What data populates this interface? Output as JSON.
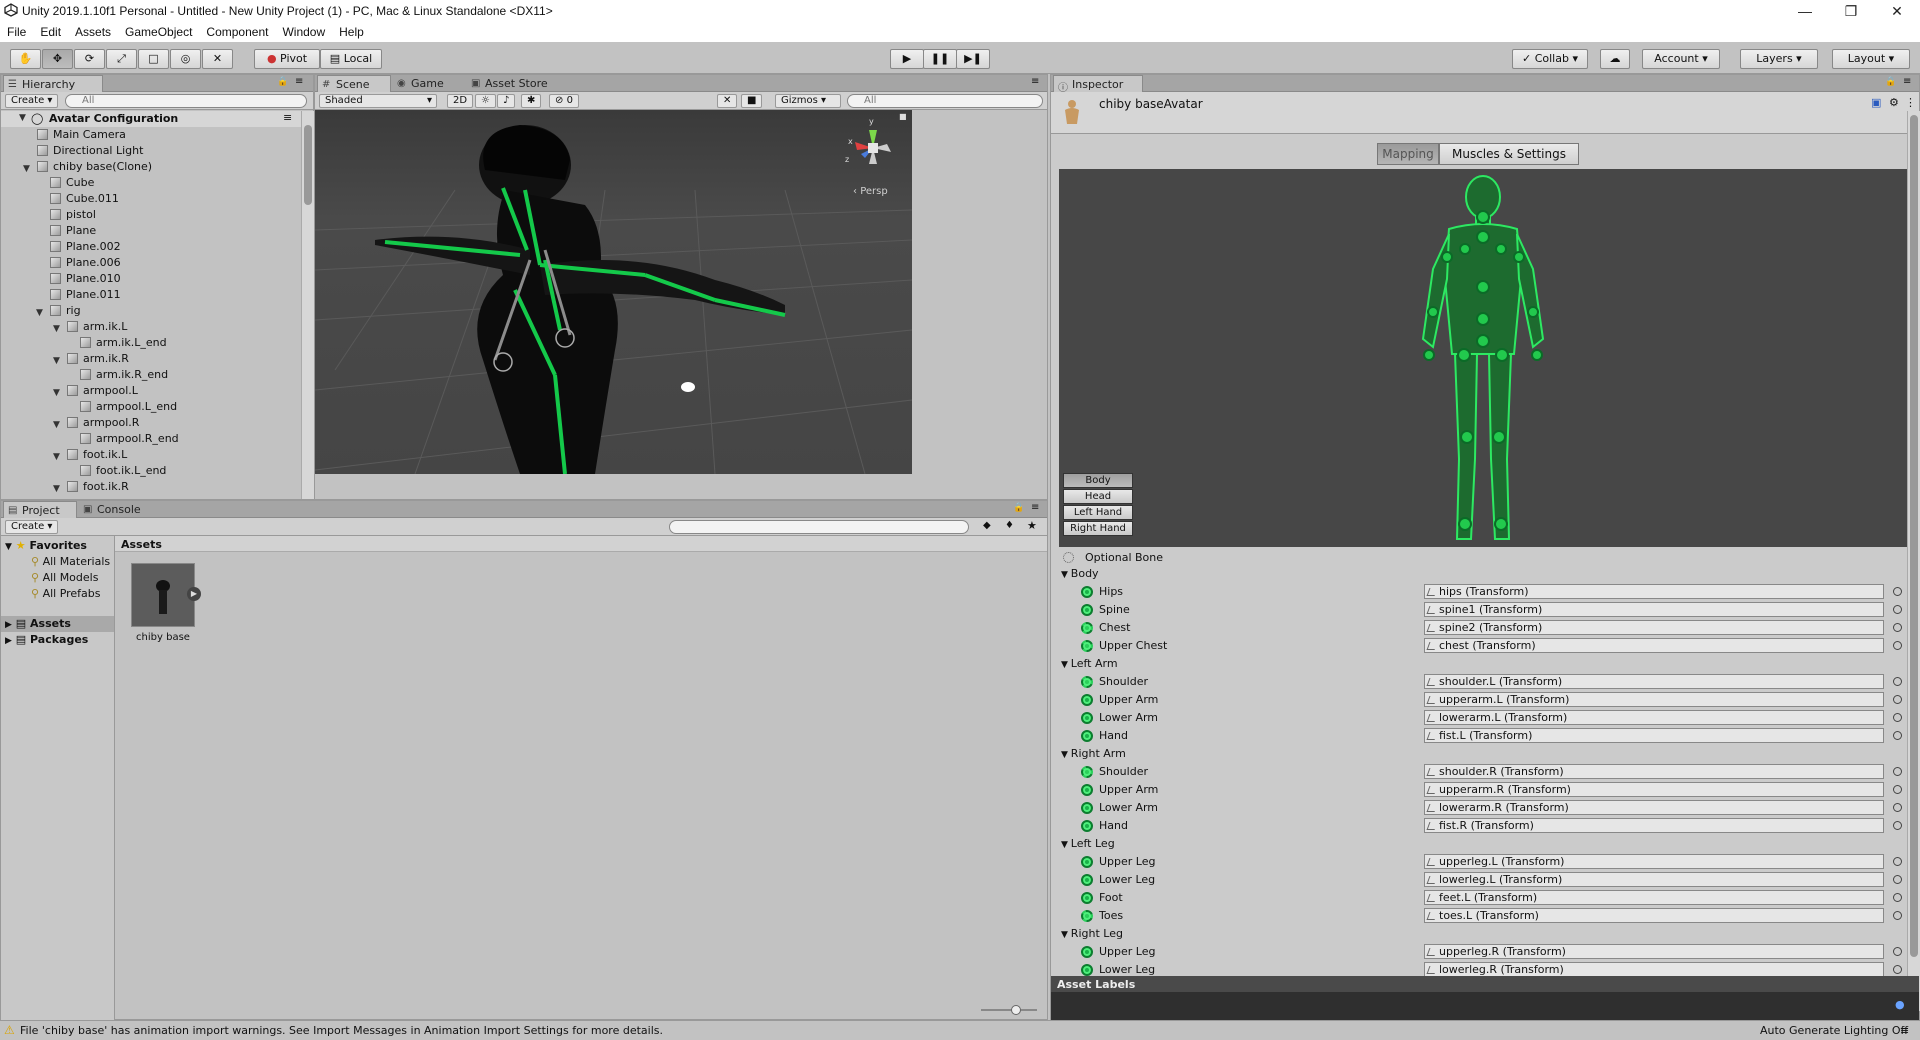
{
  "window": {
    "title": "Unity 2019.1.10f1 Personal - Untitled - New Unity Project (1) - PC, Mac & Linux Standalone <DX11>"
  },
  "menu": [
    "File",
    "Edit",
    "Assets",
    "GameObject",
    "Component",
    "Window",
    "Help"
  ],
  "toolbar": {
    "pivot": "Pivot",
    "local": "Local",
    "collab": "Collab ▾",
    "account": "Account ▾",
    "layers": "Layers ▾",
    "layout": "Layout ▾"
  },
  "hierarchy": {
    "tab": "Hierarchy",
    "create": "Create ▾",
    "search_placeholder": "All",
    "root": "Avatar Configuration",
    "items": [
      {
        "label": "Main Camera",
        "depth": 1
      },
      {
        "label": "Directional Light",
        "depth": 1
      },
      {
        "label": "chiby base(Clone)",
        "depth": 1,
        "expanded": true
      },
      {
        "label": "Cube",
        "depth": 2
      },
      {
        "label": "Cube.011",
        "depth": 2
      },
      {
        "label": "pistol",
        "depth": 2
      },
      {
        "label": "Plane",
        "depth": 2
      },
      {
        "label": "Plane.002",
        "depth": 2
      },
      {
        "label": "Plane.006",
        "depth": 2
      },
      {
        "label": "Plane.010",
        "depth": 2
      },
      {
        "label": "Plane.011",
        "depth": 2
      },
      {
        "label": "rig",
        "depth": 2,
        "expanded": true
      },
      {
        "label": "arm.ik.L",
        "depth": 3,
        "expanded": true
      },
      {
        "label": "arm.ik.L_end",
        "depth": 4
      },
      {
        "label": "arm.ik.R",
        "depth": 3,
        "expanded": true
      },
      {
        "label": "arm.ik.R_end",
        "depth": 4
      },
      {
        "label": "armpool.L",
        "depth": 3,
        "expanded": true
      },
      {
        "label": "armpool.L_end",
        "depth": 4
      },
      {
        "label": "armpool.R",
        "depth": 3,
        "expanded": true
      },
      {
        "label": "armpool.R_end",
        "depth": 4
      },
      {
        "label": "foot.ik.L",
        "depth": 3,
        "expanded": true
      },
      {
        "label": "foot.ik.L_end",
        "depth": 4
      },
      {
        "label": "foot.ik.R",
        "depth": 3,
        "expanded": true
      }
    ]
  },
  "scene": {
    "tabs": [
      "Scene",
      "Game",
      "Asset Store"
    ],
    "shading": "Shaded",
    "mode2d": "2D",
    "fx_count": "0",
    "gizmos": "Gizmos ▾",
    "search_placeholder": "All",
    "persp": "Persp",
    "axis_y": "y",
    "axis_x": "x",
    "axis_z": "z"
  },
  "project": {
    "tabs": [
      "Project",
      "Console"
    ],
    "create": "Create ▾",
    "favorites": "Favorites",
    "fav_items": [
      "All Materials",
      "All Models",
      "All Prefabs"
    ],
    "roots": [
      "Assets",
      "Packages"
    ],
    "assets_header": "Assets",
    "asset_name": "chiby base"
  },
  "inspector": {
    "tab": "Inspector",
    "object_name": "chiby baseAvatar",
    "mapping": "Mapping",
    "muscles": "Muscles & Settings",
    "body_buttons": [
      "Body",
      "Head",
      "Left Hand",
      "Right Hand"
    ],
    "optional_bone": "Optional Bone",
    "groups": [
      {
        "name": "Body",
        "bones": [
          {
            "label": "Hips",
            "value": "hips (Transform)",
            "optional": false
          },
          {
            "label": "Spine",
            "value": "spine1 (Transform)",
            "optional": false
          },
          {
            "label": "Chest",
            "value": "spine2 (Transform)",
            "optional": true
          },
          {
            "label": "Upper Chest",
            "value": "chest (Transform)",
            "optional": true
          }
        ]
      },
      {
        "name": "Left Arm",
        "bones": [
          {
            "label": "Shoulder",
            "value": "shoulder.L (Transform)",
            "optional": true
          },
          {
            "label": "Upper Arm",
            "value": "upperarm.L (Transform)",
            "optional": false
          },
          {
            "label": "Lower Arm",
            "value": "lowerarm.L (Transform)",
            "optional": false
          },
          {
            "label": "Hand",
            "value": "fist.L (Transform)",
            "optional": false
          }
        ]
      },
      {
        "name": "Right Arm",
        "bones": [
          {
            "label": "Shoulder",
            "value": "shoulder.R (Transform)",
            "optional": true
          },
          {
            "label": "Upper Arm",
            "value": "upperarm.R (Transform)",
            "optional": false
          },
          {
            "label": "Lower Arm",
            "value": "lowerarm.R (Transform)",
            "optional": false
          },
          {
            "label": "Hand",
            "value": "fist.R (Transform)",
            "optional": false
          }
        ]
      },
      {
        "name": "Left Leg",
        "bones": [
          {
            "label": "Upper Leg",
            "value": "upperleg.L (Transform)",
            "optional": false
          },
          {
            "label": "Lower Leg",
            "value": "lowerleg.L (Transform)",
            "optional": false
          },
          {
            "label": "Foot",
            "value": "feet.L (Transform)",
            "optional": false
          },
          {
            "label": "Toes",
            "value": "toes.L (Transform)",
            "optional": true
          }
        ]
      },
      {
        "name": "Right Leg",
        "bones": [
          {
            "label": "Upper Leg",
            "value": "upperleg.R (Transform)",
            "optional": false
          },
          {
            "label": "Lower Leg",
            "value": "lowerleg.R (Transform)",
            "optional": false
          }
        ]
      }
    ],
    "asset_labels": "Asset Labels"
  },
  "status": {
    "message": "File 'chiby base' has animation import warnings. See Import Messages in Animation Import Settings for more details.",
    "right": "Auto Generate Lighting Off"
  },
  "colors": {
    "bone_green": "#1ab14a",
    "scene_bg": "#464646"
  }
}
